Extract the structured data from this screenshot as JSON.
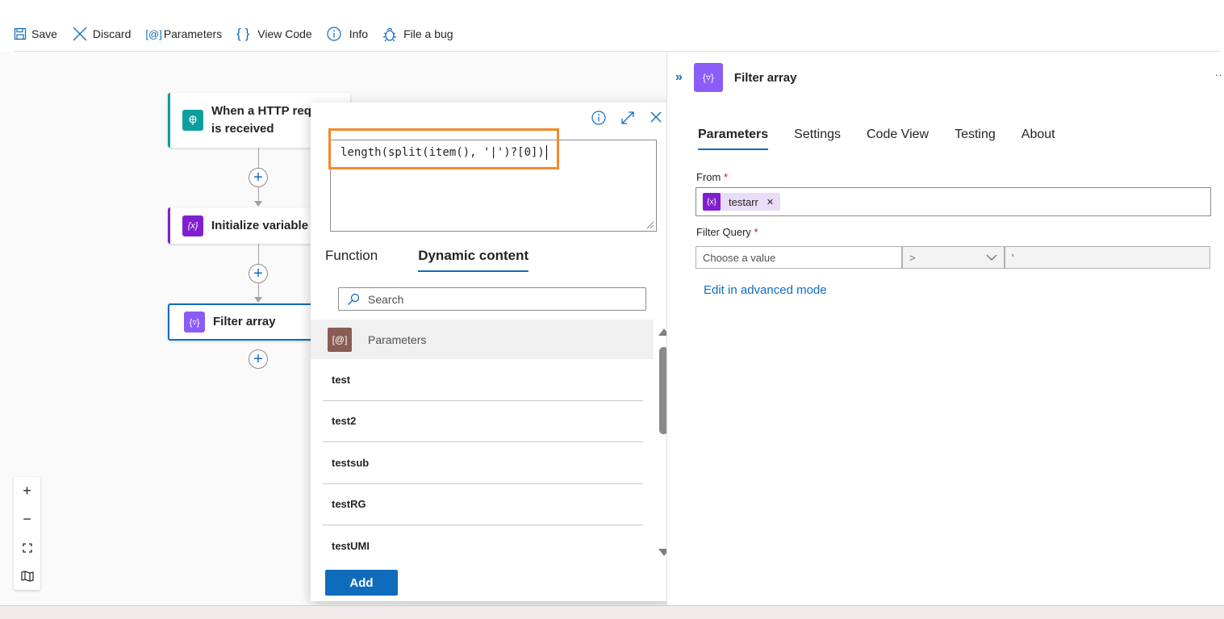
{
  "toolbar": {
    "save": "Save",
    "discard": "Discard",
    "parameters": "Parameters",
    "view_code": "View Code",
    "info": "Info",
    "file_bug": "File a bug"
  },
  "canvas": {
    "nodes": [
      {
        "label": "When a HTTP request is received",
        "label_visible": "When a HTTP req\nis received",
        "icon": "http-trigger-icon",
        "color": "#0e9e9e"
      },
      {
        "label": "Initialize variable",
        "icon": "variable-icon",
        "color": "#7f1fd0"
      },
      {
        "label": "Filter array",
        "icon": "filter-array-icon",
        "color": "#8b5cf6"
      }
    ],
    "zoom_controls": [
      "+",
      "−",
      "fit",
      "map"
    ]
  },
  "popup": {
    "expression": "length(split(item(), '|')?[0])",
    "tabs": [
      "Function",
      "Dynamic content"
    ],
    "active_tab": "Dynamic content",
    "search_placeholder": "Search",
    "group": {
      "label": "Parameters",
      "icon": "[@]"
    },
    "items": [
      "test",
      "test2",
      "testsub",
      "testRG",
      "testUMI"
    ],
    "add_button": "Add"
  },
  "panel": {
    "title": "Filter array",
    "tabs": [
      "Parameters",
      "Settings",
      "Code View",
      "Testing",
      "About"
    ],
    "active_tab": "Parameters",
    "from_label": "From",
    "from_token": "testarr",
    "filter_query_label": "Filter Query",
    "choose_placeholder": "Choose a value",
    "operator": ">",
    "value": "'",
    "advanced_link": "Edit in advanced mode",
    "more": "··"
  },
  "colors": {
    "accent": "#0f6cbd",
    "highlight": "#f38a2b"
  }
}
